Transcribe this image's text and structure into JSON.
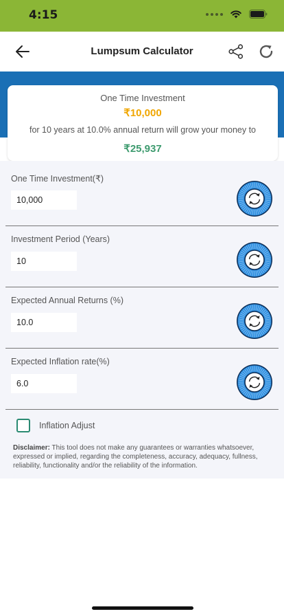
{
  "status": {
    "time": "4:15"
  },
  "nav": {
    "title": "Lumpsum Calculator"
  },
  "summary": {
    "title": "One Time Investment",
    "amount": "₹10,000",
    "description": "for 10 years at 10.0% annual return will grow your money to",
    "result": "₹25,937"
  },
  "fields": [
    {
      "label": "One Time Investment(₹)",
      "value": "10,000"
    },
    {
      "label": "Investment Period (Years)",
      "value": "10"
    },
    {
      "label": "Expected Annual Returns (%)",
      "value": "10.0"
    },
    {
      "label": "Expected Inflation rate(%)",
      "value": "6.0"
    }
  ],
  "inflation_adjust": {
    "label": "Inflation Adjust",
    "checked": false
  },
  "disclaimer": {
    "label": "Disclaimer:",
    "text": " This tool does not make any guarantees or warranties whatsoever, expressed or implied, regarding the completeness, accuracy, adequacy, fullness, reliability, functionality and/or the reliability of the information."
  },
  "colors": {
    "status_bar": "#8bb636",
    "header_band": "#1a6fb5",
    "amount": "#f0a600",
    "result": "#3e9b6f",
    "dial": "#2f8fe0",
    "checkbox": "#2a8a72"
  }
}
